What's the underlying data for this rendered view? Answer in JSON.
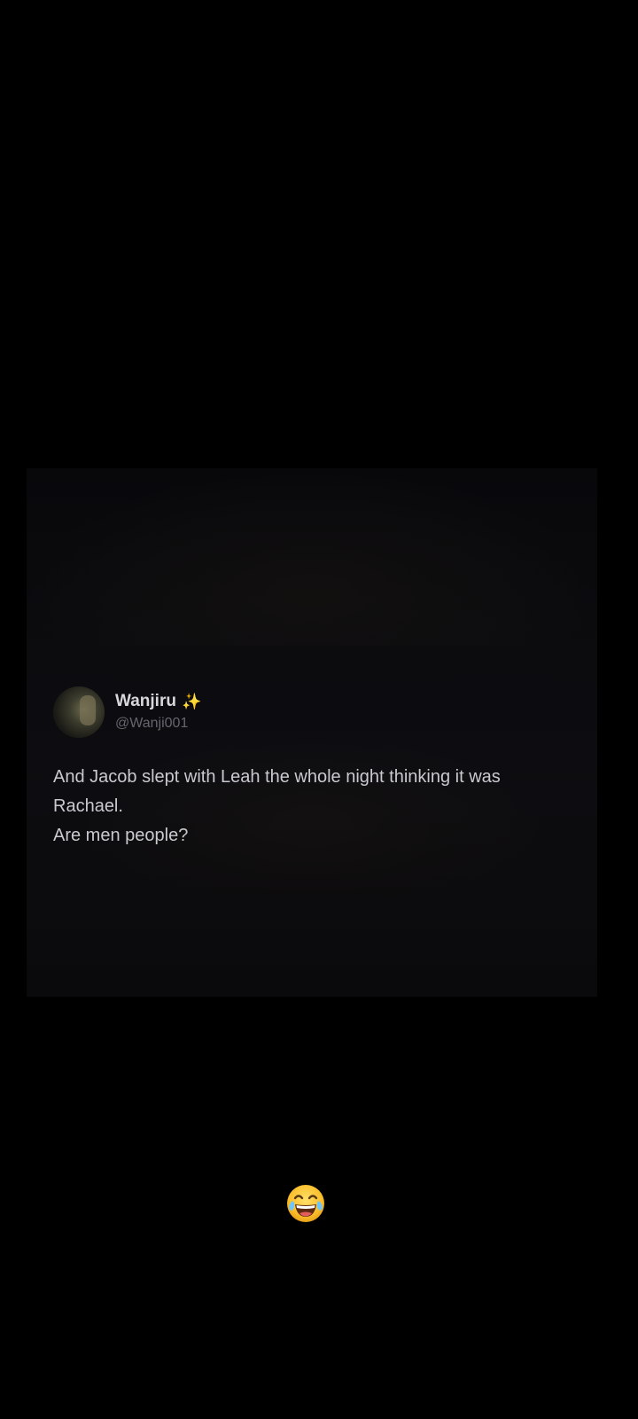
{
  "tweet": {
    "display_name": "Wanjiru",
    "handle": "@Wanji001",
    "name_icon": "sparkles-icon",
    "text_lines": [
      "And Jacob slept with Leah the whole night thinking it was",
      "Rachael.",
      "Are men people?"
    ]
  },
  "reaction": {
    "emoji": "face-with-tears-of-joy-icon"
  },
  "colors": {
    "background": "#000000",
    "tweet_text": "#c9c9cf",
    "handle": "#65666c",
    "sparkle": "#caa94a"
  }
}
